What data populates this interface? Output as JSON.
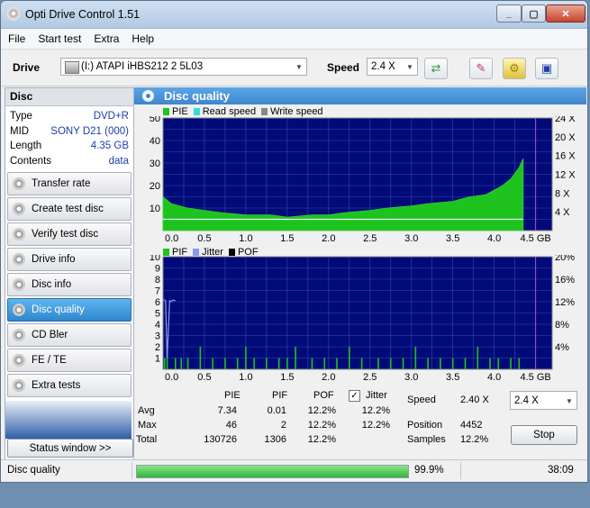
{
  "window": {
    "title": "Opti Drive Control 1.51",
    "minimize": "_",
    "maximize": "▢",
    "close": "✕"
  },
  "menu": [
    "File",
    "Start test",
    "Extra",
    "Help"
  ],
  "toolbar": {
    "drive_label": "Drive",
    "drive_value": "(I:)   ATAPI iHBS212   2 5L03",
    "speed_label": "Speed",
    "speed_value": "2.4 X"
  },
  "disc": {
    "header": "Disc",
    "rows": [
      {
        "k": "Type",
        "v": "DVD+R"
      },
      {
        "k": "MID",
        "v": "SONY D21 (000)"
      },
      {
        "k": "Length",
        "v": "4.35 GB"
      },
      {
        "k": "Contents",
        "v": "data"
      }
    ]
  },
  "nav": [
    {
      "label": "Transfer rate"
    },
    {
      "label": "Create test disc"
    },
    {
      "label": "Verify test disc"
    },
    {
      "label": "Drive info"
    },
    {
      "label": "Disc info"
    },
    {
      "label": "Disc quality",
      "active": true
    },
    {
      "label": "CD Bler"
    },
    {
      "label": "FE / TE"
    },
    {
      "label": "Extra tests"
    }
  ],
  "status_window_btn": "Status window >>",
  "panel_title": "Disc quality",
  "chart_data": [
    {
      "type": "area",
      "legend": [
        "PIE",
        "Read speed",
        "Write speed"
      ],
      "legend_colors": [
        "#1ec31e",
        "#33dddd",
        "#888888"
      ],
      "x_ticks": [
        "0.0",
        "0.5",
        "1.0",
        "1.5",
        "2.0",
        "2.5",
        "3.0",
        "3.5",
        "4.0",
        "4.5 GB"
      ],
      "xlim": [
        0,
        4.7
      ],
      "y_left_ticks": [
        "10",
        "20",
        "30",
        "40",
        "50"
      ],
      "ylim_left": [
        0,
        50
      ],
      "y_right_ticks": [
        "4 X",
        "8 X",
        "12 X",
        "16 X",
        "20 X",
        "24 X"
      ],
      "ylim_right": [
        0,
        24
      ],
      "pie_x": [
        0.0,
        0.1,
        0.2,
        0.3,
        0.5,
        0.7,
        1.0,
        1.3,
        1.5,
        1.8,
        2.0,
        2.2,
        2.5,
        2.7,
        3.0,
        3.2,
        3.5,
        3.7,
        3.9,
        4.0,
        4.1,
        4.2,
        4.3,
        4.35
      ],
      "pie_y": [
        15,
        12,
        11,
        10,
        9,
        8,
        7,
        7,
        6,
        7,
        7,
        8,
        9,
        10,
        11,
        12,
        13,
        15,
        16,
        18,
        20,
        23,
        28,
        32
      ],
      "read_speed": 2.4
    },
    {
      "type": "bar",
      "legend": [
        "PIF",
        "Jitter",
        "POF"
      ],
      "legend_colors": [
        "#1ec31e",
        "#8899ee",
        "#000000"
      ],
      "x_ticks": [
        "0.0",
        "0.5",
        "1.0",
        "1.5",
        "2.0",
        "2.5",
        "3.0",
        "3.5",
        "4.0",
        "4.5 GB"
      ],
      "xlim": [
        0,
        4.7
      ],
      "y_left_ticks": [
        "1",
        "2",
        "3",
        "4",
        "5",
        "6",
        "7",
        "8",
        "9",
        "10"
      ],
      "ylim_left": [
        0,
        10
      ],
      "y_right_ticks": [
        "4%",
        "8%",
        "12%",
        "16%",
        "20%"
      ],
      "ylim_right": [
        0,
        20
      ],
      "pif_x": [
        0.02,
        0.05,
        0.15,
        0.22,
        0.3,
        0.45,
        0.6,
        0.75,
        0.9,
        1.0,
        1.1,
        1.25,
        1.4,
        1.5,
        1.6,
        1.8,
        1.95,
        2.1,
        2.25,
        2.4,
        2.6,
        2.75,
        2.9,
        3.05,
        3.2,
        3.35,
        3.5,
        3.65,
        3.8,
        3.95,
        4.05,
        4.2,
        4.3
      ],
      "pif_y": [
        1,
        2,
        1,
        1,
        1,
        2,
        1,
        1,
        1,
        2,
        1,
        1,
        1,
        1,
        2,
        1,
        1,
        1,
        2,
        1,
        1,
        1,
        1,
        2,
        1,
        1,
        1,
        1,
        2,
        1,
        1,
        1,
        1
      ],
      "jitter_x": [
        0.0,
        0.03,
        0.05,
        0.08,
        0.1,
        0.12,
        0.15
      ],
      "jitter_y": [
        12.4,
        12.2,
        2.0,
        12.2,
        12.0,
        12.3,
        12.2
      ]
    }
  ],
  "stats": {
    "headers": [
      "PIE",
      "PIF",
      "POF",
      "Jitter"
    ],
    "rows": [
      {
        "label": "Avg",
        "pie": "7.34",
        "pif": "0.01",
        "pof": "12.2%",
        "jitter": "12.2%"
      },
      {
        "label": "Max",
        "pie": "46",
        "pif": "2",
        "pof": "12.2%",
        "jitter": "12.2%"
      },
      {
        "label": "Total",
        "pie": "130726",
        "pif": "1306",
        "pof": "12.2%"
      }
    ],
    "jitter_checked": "✓",
    "speed_label": "Speed",
    "speed_value": "2.40 X",
    "speed_select": "2.4 X",
    "position_label": "Position",
    "position_value": "4452",
    "samples_label": "Samples",
    "samples_value": "12.2%",
    "stop_label": "Stop"
  },
  "statusbar": {
    "text": "Disc quality",
    "progress_text": "99.9%",
    "progress": 0.999,
    "time": "38:09"
  }
}
